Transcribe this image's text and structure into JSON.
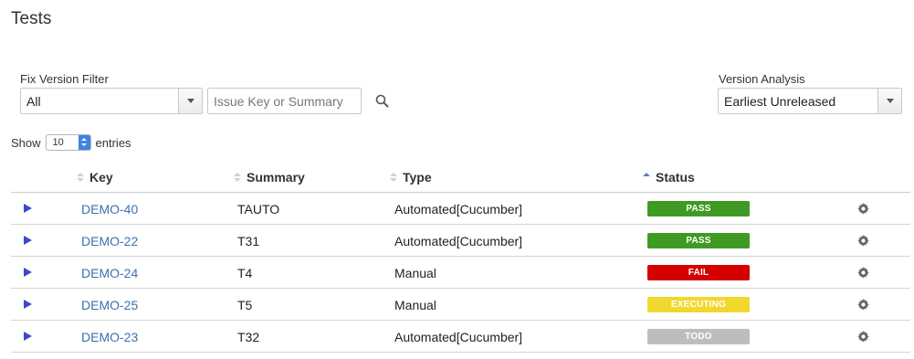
{
  "page": {
    "title": "Tests"
  },
  "filters": {
    "fix_version_label": "Fix Version Filter",
    "fix_version_value": "All",
    "search_placeholder": "Issue Key or Summary",
    "version_analysis_label": "Version Analysis",
    "version_analysis_value": "Earliest Unreleased"
  },
  "length": {
    "show_label": "Show",
    "value": "10",
    "entries_label": "entries"
  },
  "table": {
    "columns": {
      "key": "Key",
      "summary": "Summary",
      "type": "Type",
      "status": "Status"
    },
    "sorted_column": "status",
    "rows": [
      {
        "key": "DEMO-40",
        "summary": "TAUTO",
        "type": "Automated[Cucumber]",
        "status": "PASS",
        "status_color": "#3f9a23"
      },
      {
        "key": "DEMO-22",
        "summary": "T31",
        "type": "Automated[Cucumber]",
        "status": "PASS",
        "status_color": "#3f9a23"
      },
      {
        "key": "DEMO-24",
        "summary": "T4",
        "type": "Manual",
        "status": "FAIL",
        "status_color": "#d40000"
      },
      {
        "key": "DEMO-25",
        "summary": "T5",
        "type": "Manual",
        "status": "EXECUTING",
        "status_color": "#f1d82e"
      },
      {
        "key": "DEMO-23",
        "summary": "T32",
        "type": "Automated[Cucumber]",
        "status": "TODO",
        "status_color": "#bdbdbd"
      }
    ]
  },
  "icons": {
    "search": "search-icon",
    "gear": "gear-icon",
    "expand": "expand-arrow-icon"
  }
}
